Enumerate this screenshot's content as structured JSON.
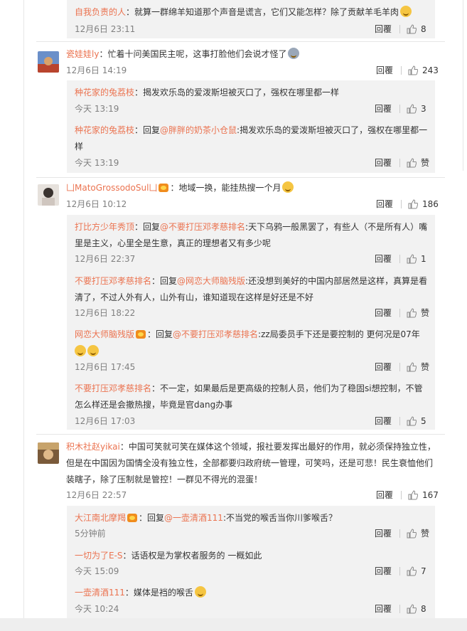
{
  "actions": {
    "reply": "回覆"
  },
  "comments": [
    {
      "user": "自我负责的人",
      "text": "：就算一群绵羊知道那个声音是谎言，它们又能怎样？除了贡献羊毛羊肉",
      "time": "12月6日 23:11",
      "likes": "8"
    },
    {
      "user": "瓷娃娃ly",
      "text": "：忙着十问美国民主呢，这事打脸他们会说才怪了",
      "time": "12月6日 14:19",
      "likes": "243",
      "replies": [
        {
          "user": "种花家的兔荔枝",
          "text": "：揭发欢乐岛的爱泼斯坦被灭口了，强权在哪里都一样",
          "time": "今天 13:19",
          "likes": "3"
        },
        {
          "user": "种花家的兔荔枝",
          "text_prefix": "：回复",
          "mention": "@胖胖的奶茶小仓鼠",
          "text": ":揭发欢乐岛的爱泼斯坦被灭口了，强权在哪里都一",
          "text_line2": "样",
          "time": "今天 13:19",
          "likes": "赞"
        }
      ]
    },
    {
      "user": "凵MatoGrossodoSul凵",
      "text": "：地域一换，能挂热搜一个月",
      "time": "12月6日 10:12",
      "likes": "186",
      "replies": [
        {
          "user": "打比方少年秀顶",
          "text_prefix": "：回复",
          "mention": "@不要打压邓孝慈排名",
          "text": ":天下乌鸦一般黑罢了，有些人（不是所有人）嘴",
          "text_line2": "里是主义，心里全是生意，真正的理想者又有多少呢",
          "time": "12月6日 22:37",
          "likes": "1"
        },
        {
          "user": "不要打压邓孝慈排名",
          "text_prefix": "：回复",
          "mention": "@网恋大师脑残版",
          "text": ":还没想到美好的中国内部居然是这样，真算是看",
          "text_line2": "清了，不过人外有人，山外有山，谁知道现在这样是好还是不好",
          "time": "12月6日 18:22",
          "likes": "赞"
        },
        {
          "user": "网恋大师脑残版",
          "text_prefix": "：回复",
          "mention": "@不要打压邓孝慈排名",
          "text": ":zz局委员手下还是要控制的 更何况是07年",
          "time": "12月6日 17:45",
          "likes": "赞"
        },
        {
          "user": "不要打压邓孝慈排名",
          "text": "：不一定，如果最后是更高级的控制人员，他们为了稳固si想控制，不管",
          "text_line2": "怎么样还是会撤热搜，毕竟是官dang办事",
          "time": "12月6日 17:03",
          "likes": "5"
        }
      ]
    },
    {
      "user": "积木社赵yikai",
      "text": "：中国可笑就可笑在媒体这个领域，报社要发挥出最好的作用，就必须保持独立性，",
      "text_line2": "但是在中国因为国情全没有独立性，全部都要归政府统一管理，可笑吗，还是可悲！民生衰恤他们",
      "text_line3": "装瞎子，除了压制就是管控！一群见不得光的混蛋！",
      "time": "12月6日 22:57",
      "likes": "167",
      "replies": [
        {
          "user": "大江南北摩羯",
          "text_prefix": "：回复",
          "mention": "@一壶清酒111",
          "text": ":不当党的喉舌当你川爹喉舌？",
          "time": "5分钟前",
          "likes": "赞"
        },
        {
          "user": "一切为了E-S",
          "text": "：话语权是为掌权者服务的 一概如此",
          "time": "今天 15:09",
          "likes": "7"
        },
        {
          "user": "一壶清酒111",
          "text": "：媒体是裆的喉舌",
          "time": "今天 10:24",
          "likes": "8"
        }
      ]
    }
  ]
}
